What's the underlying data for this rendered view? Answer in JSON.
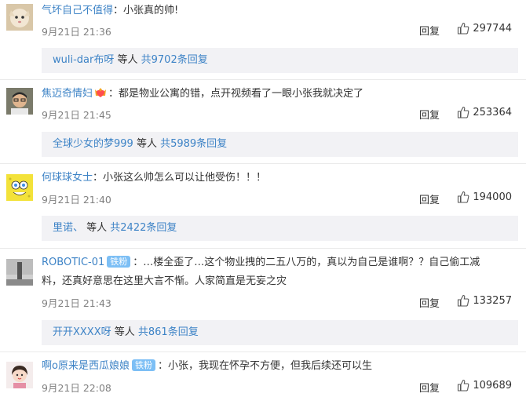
{
  "comments": [
    {
      "user": "气坏自己不值得",
      "text": "：小张真的帅!",
      "date": "9月21日 21:36",
      "reply_label": "回复",
      "likes": "297744",
      "replies": {
        "who": "wuli-dar布呀",
        "mid": " 等人 ",
        "count": "共9702条回复"
      }
    },
    {
      "user": "焦迈奇情妇",
      "text": "：都是物业公寓的错，点开视频看了一眼小张我就决定了",
      "date": "9月21日 21:45",
      "reply_label": "回复",
      "likes": "253364",
      "replies": {
        "who": "全球少女的梦999",
        "mid": " 等人 ",
        "count": "共5989条回复"
      }
    },
    {
      "user": "何球球女士",
      "text": "：小张这么帅怎么可以让他受伤！！！",
      "date": "9月21日 21:40",
      "reply_label": "回复",
      "likes": "194000",
      "replies": {
        "who": "里诺、",
        "mid": " 等人 ",
        "count": "共2422条回复"
      }
    },
    {
      "user": "ROBOTIC-01",
      "badge": "铁粉",
      "text": "：…楼全歪了…这个物业拽的二五八万的，真以为自己是谁啊？？自己偷工减",
      "text2": "料，还真好意思在这里大言不惭。人家简直是无妄之灾",
      "date": "9月21日 21:43",
      "reply_label": "回复",
      "likes": "133257",
      "replies": {
        "who": "开开XXXX呀",
        "mid": " 等人 ",
        "count": "共861条回复"
      }
    },
    {
      "user": "啊o原来是西瓜娘娘",
      "badge": "铁粉",
      "text": "：小张，我现在怀孕不方便，但我后续还可以生",
      "date": "9月21日 22:08",
      "reply_label": "回复",
      "likes": "109689"
    }
  ]
}
